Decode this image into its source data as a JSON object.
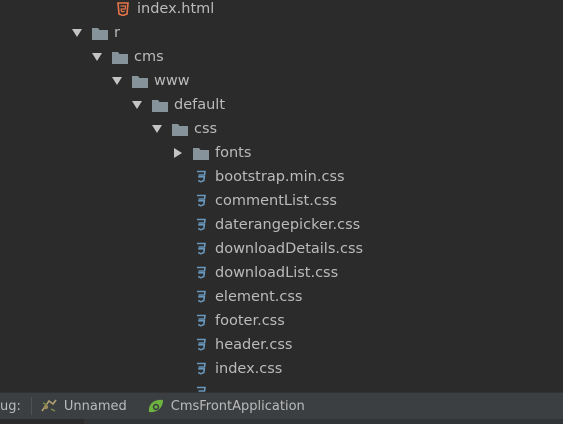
{
  "tree": {
    "rows": [
      {
        "label": "index.html",
        "kind": "html"
      },
      {
        "label": "r",
        "kind": "folder",
        "expanded": true
      },
      {
        "label": "cms",
        "kind": "folder",
        "expanded": true
      },
      {
        "label": "www",
        "kind": "folder",
        "expanded": true
      },
      {
        "label": "default",
        "kind": "folder",
        "expanded": true
      },
      {
        "label": "css",
        "kind": "folder",
        "expanded": true
      },
      {
        "label": "fonts",
        "kind": "folder",
        "expanded": false
      },
      {
        "label": "bootstrap.min.css",
        "kind": "css"
      },
      {
        "label": "commentList.css",
        "kind": "css"
      },
      {
        "label": "daterangepicker.css",
        "kind": "css"
      },
      {
        "label": "downloadDetails.css",
        "kind": "css"
      },
      {
        "label": "downloadList.css",
        "kind": "css"
      },
      {
        "label": "element.css",
        "kind": "css"
      },
      {
        "label": "footer.css",
        "kind": "css"
      },
      {
        "label": "header.css",
        "kind": "css"
      },
      {
        "label": "index.css",
        "kind": "css"
      }
    ]
  },
  "statusbar": {
    "prefix": "ug:",
    "items": [
      {
        "label": "Unnamed",
        "icon": "bug-config-icon"
      },
      {
        "label": "CmsFrontApplication",
        "icon": "spring-boot-icon"
      }
    ]
  },
  "colors": {
    "folder": "#87939a",
    "css_icon": "#6897bb",
    "html_icon": "#e8754a",
    "arrow": "#c4c4c4",
    "spring": "#6db33f"
  }
}
